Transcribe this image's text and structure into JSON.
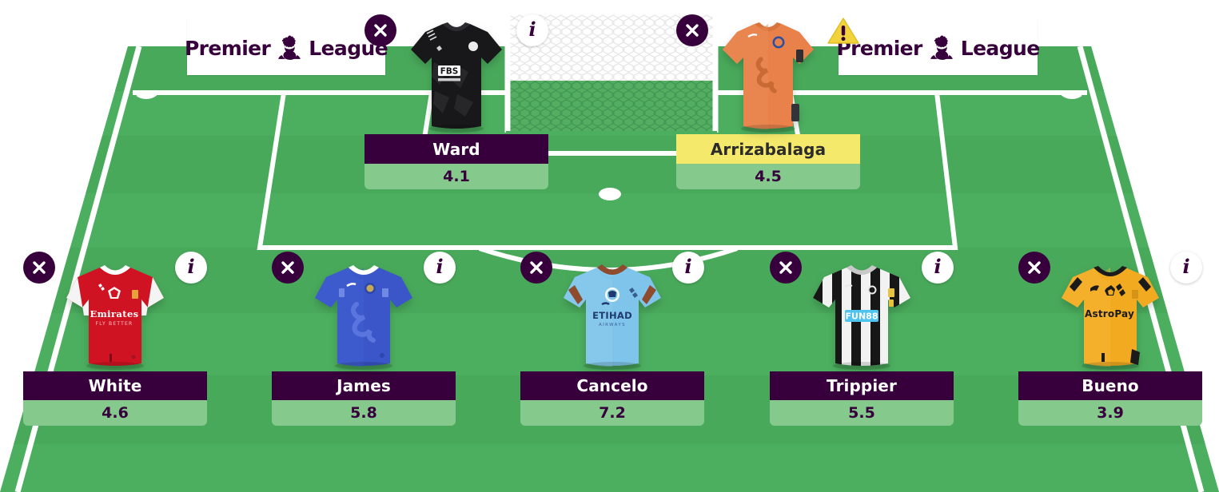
{
  "adverts": [
    {
      "text_left": "Premier",
      "text_right": "League",
      "logo": "premier-league-lion-icon"
    },
    {
      "text_left": "Premier",
      "text_right": "League",
      "logo": "premier-league-lion-icon"
    }
  ],
  "colors": {
    "brand_purple": "#37003c",
    "pitch_green": "#4caf5f",
    "pitch_green_dark": "#47a758",
    "price_bar_green": "#85c98d",
    "flag_yellow": "#f5e96b",
    "white": "#ffffff"
  },
  "icons": {
    "remove": "close-x-icon",
    "info": "info-icon",
    "warning": "warning-triangle-icon",
    "info_glyph": "i",
    "warning_glyph": "!"
  },
  "goalkeepers": [
    {
      "name": "Ward",
      "price": "4.1",
      "club": "Leicester City",
      "kit": "goalkeeper-black",
      "flagged": false,
      "remove_label": "Remove Ward",
      "info_label": "Ward information"
    },
    {
      "name": "Arrizabalaga",
      "price": "4.5",
      "club": "Chelsea",
      "kit": "goalkeeper-orange",
      "flagged": true,
      "remove_label": "Remove Arrizabalaga",
      "info_label": "Arrizabalaga status warning"
    }
  ],
  "defenders": [
    {
      "name": "White",
      "price": "4.6",
      "club": "Arsenal",
      "kit": "outfield-arsenal",
      "flagged": false,
      "remove_label": "Remove White",
      "info_label": "White information"
    },
    {
      "name": "James",
      "price": "5.8",
      "club": "Chelsea",
      "kit": "outfield-chelsea",
      "flagged": false,
      "remove_label": "Remove James",
      "info_label": "James information"
    },
    {
      "name": "Cancelo",
      "price": "7.2",
      "club": "Manchester City",
      "kit": "outfield-mancity",
      "flagged": false,
      "remove_label": "Remove Cancelo",
      "info_label": "Cancelo information"
    },
    {
      "name": "Trippier",
      "price": "5.5",
      "club": "Newcastle United",
      "kit": "outfield-newcastle",
      "flagged": false,
      "remove_label": "Remove Trippier",
      "info_label": "Trippier information"
    },
    {
      "name": "Bueno",
      "price": "3.9",
      "club": "Wolverhampton Wanderers",
      "kit": "outfield-wolves",
      "flagged": false,
      "remove_label": "Remove Bueno",
      "info_label": "Bueno information"
    }
  ]
}
